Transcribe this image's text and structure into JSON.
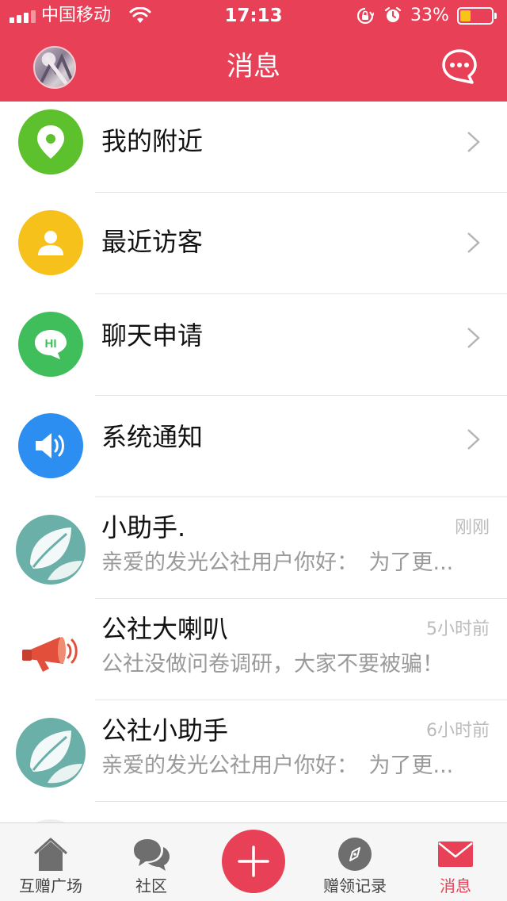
{
  "status_bar": {
    "carrier": "中国移动",
    "time": "17:13",
    "battery_percent": "33%",
    "battery_level": 0.33,
    "battery_fill_color": "#f7c417",
    "icons": [
      "signal-icon",
      "wifi-icon",
      "rotation-lock-icon",
      "alarm-icon",
      "battery-icon"
    ]
  },
  "header": {
    "title": "消息",
    "left_icon": "user-avatar",
    "right_icon": "chat-bubble-icon"
  },
  "menu": [
    {
      "label": "我的附近",
      "icon": "location-pin-icon",
      "color": "#5cc12d"
    },
    {
      "label": "最近访客",
      "icon": "person-icon",
      "color": "#f7c11b"
    },
    {
      "label": "聊天申请",
      "icon": "hi-bubble-icon",
      "icon_text": "HI",
      "color": "#3fbe5b"
    },
    {
      "label": "系统通知",
      "icon": "speaker-icon",
      "color": "#2b8ef0"
    }
  ],
  "messages": [
    {
      "name": "小助手.",
      "time": "刚刚",
      "preview": "亲爱的发光公社用户你好：　为了更...",
      "avatar": "leaf-avatar"
    },
    {
      "name": "公社大喇叭",
      "time": "5小时前",
      "preview": "公社没做问卷调研，大家不要被骗！",
      "avatar": "megaphone-avatar"
    },
    {
      "name": "公社小助手",
      "time": "6小时前",
      "preview": "亲爱的发光公社用户你好：　为了更...",
      "avatar": "leaf-avatar"
    }
  ],
  "tabs": [
    {
      "label": "互赠广场",
      "icon": "house-icon",
      "active": false
    },
    {
      "label": "社区",
      "icon": "chat-bubbles-icon",
      "active": false
    },
    {
      "label": "",
      "icon": "plus-icon",
      "active": false
    },
    {
      "label": "赠领记录",
      "icon": "compass-icon",
      "active": false
    },
    {
      "label": "消息",
      "icon": "envelope-icon",
      "active": true
    }
  ],
  "colors": {
    "brand": "#e84056",
    "active_tab": "#e84056",
    "inactive_tab_icon": "#6e6e6e",
    "divider": "#e4e4e4",
    "secondary_text": "#9a9a9a"
  }
}
